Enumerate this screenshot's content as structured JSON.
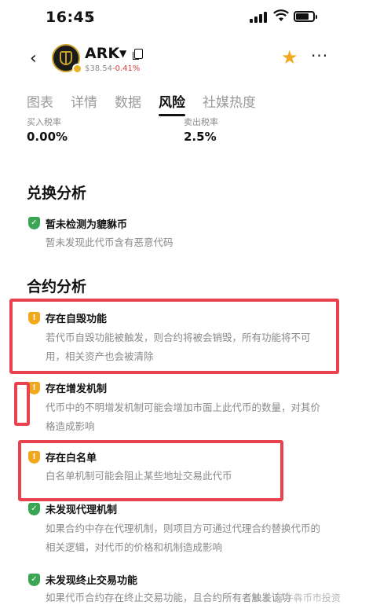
{
  "status_bar": {
    "time": "16:45"
  },
  "header": {
    "coin_name": "ARK",
    "price": "$38.54",
    "change": "-0.41%"
  },
  "tabs": [
    {
      "label": "图表",
      "active": false
    },
    {
      "label": "详情",
      "active": false
    },
    {
      "label": "数据",
      "active": false
    },
    {
      "label": "风险",
      "active": true
    },
    {
      "label": "社媒热度",
      "active": false
    }
  ],
  "tax": {
    "buy_label": "买入税率",
    "buy_value": "0.00%",
    "sell_label": "卖出税率",
    "sell_value": "2.5%"
  },
  "exchange_analysis": {
    "title": "兑换分析",
    "items": [
      {
        "status": "ok",
        "title": "暂未检测为貔貅币",
        "desc": "暂未发现此代币含有恶意代码"
      }
    ]
  },
  "contract_analysis": {
    "title": "合约分析",
    "items": [
      {
        "status": "warn",
        "title": "存在自毁功能",
        "desc": "若代币自毁功能被触发，则合约将被会销毁，所有功能将不可用，相关资产也会被清除"
      },
      {
        "status": "warn",
        "title": "存在增发机制",
        "desc": "代币中的不明增发机制可能会增加市面上此代币的数量，对其价格造成影响"
      },
      {
        "status": "warn",
        "title": "存在白名单",
        "desc": "白名单机制可能会阻止某些地址交易此代币"
      },
      {
        "status": "ok",
        "title": "未发现代理机制",
        "desc": "如果合约中存在代理机制，则项目方可通过代理合约替换代币的相关逻辑，对代币的价格和机制造成影响"
      },
      {
        "status": "ok",
        "title": "未发现终止交易功能",
        "desc": "如果代币合约存在终止交易功能，且合约所有者触发该功"
      }
    ]
  },
  "watermark": "头条 @牛犇币市投资",
  "colors": {
    "ok": "#3aa655",
    "warn": "#f2a81d",
    "highlight": "#e8424f",
    "star": "#f2a81d",
    "negative": "#d93b3b"
  }
}
